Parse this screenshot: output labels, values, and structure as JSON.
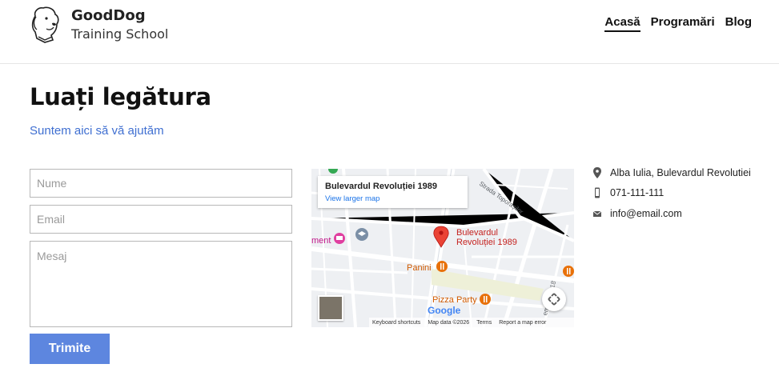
{
  "brand": {
    "name": "GoodDog",
    "subtitle": "Training School"
  },
  "nav": {
    "items": [
      "Acasă",
      "Programări",
      "Blog"
    ],
    "active": "Acasă"
  },
  "page": {
    "title": "Luați legătura",
    "subtitle": "Suntem aici să vă ajutăm"
  },
  "form": {
    "name_placeholder": "Nume",
    "email_placeholder": "Email",
    "message_placeholder": "Mesaj",
    "submit_label": "Trimite"
  },
  "map": {
    "card_title": "Bulevardul Revoluției 1989",
    "card_link": "View larger map",
    "pin_label_line1": "Bulevardul",
    "pin_label_line2": "Revoluției 1989",
    "poi_panini": "Panini",
    "poi_pizza": "Pizza Party",
    "poi_ment": "ment",
    "street_toporasilor": "Strada Toporașilor",
    "street_1918": "embrie 1918",
    "google": "Google",
    "footer": [
      "Keyboard shortcuts",
      "Map data ©2026",
      "Terms",
      "Report a map error"
    ],
    "colors": {
      "pin": "#ea4335",
      "poi": "#e8710a",
      "hotel": "#e040a0",
      "link": "#1a73e8"
    }
  },
  "contact": {
    "address": "Alba Iulia, Bulevardul Revolutiei",
    "phone": "071-111-111",
    "email": "info@email.com"
  },
  "colors": {
    "accent": "#5d86df",
    "link": "#3f6fd1"
  }
}
